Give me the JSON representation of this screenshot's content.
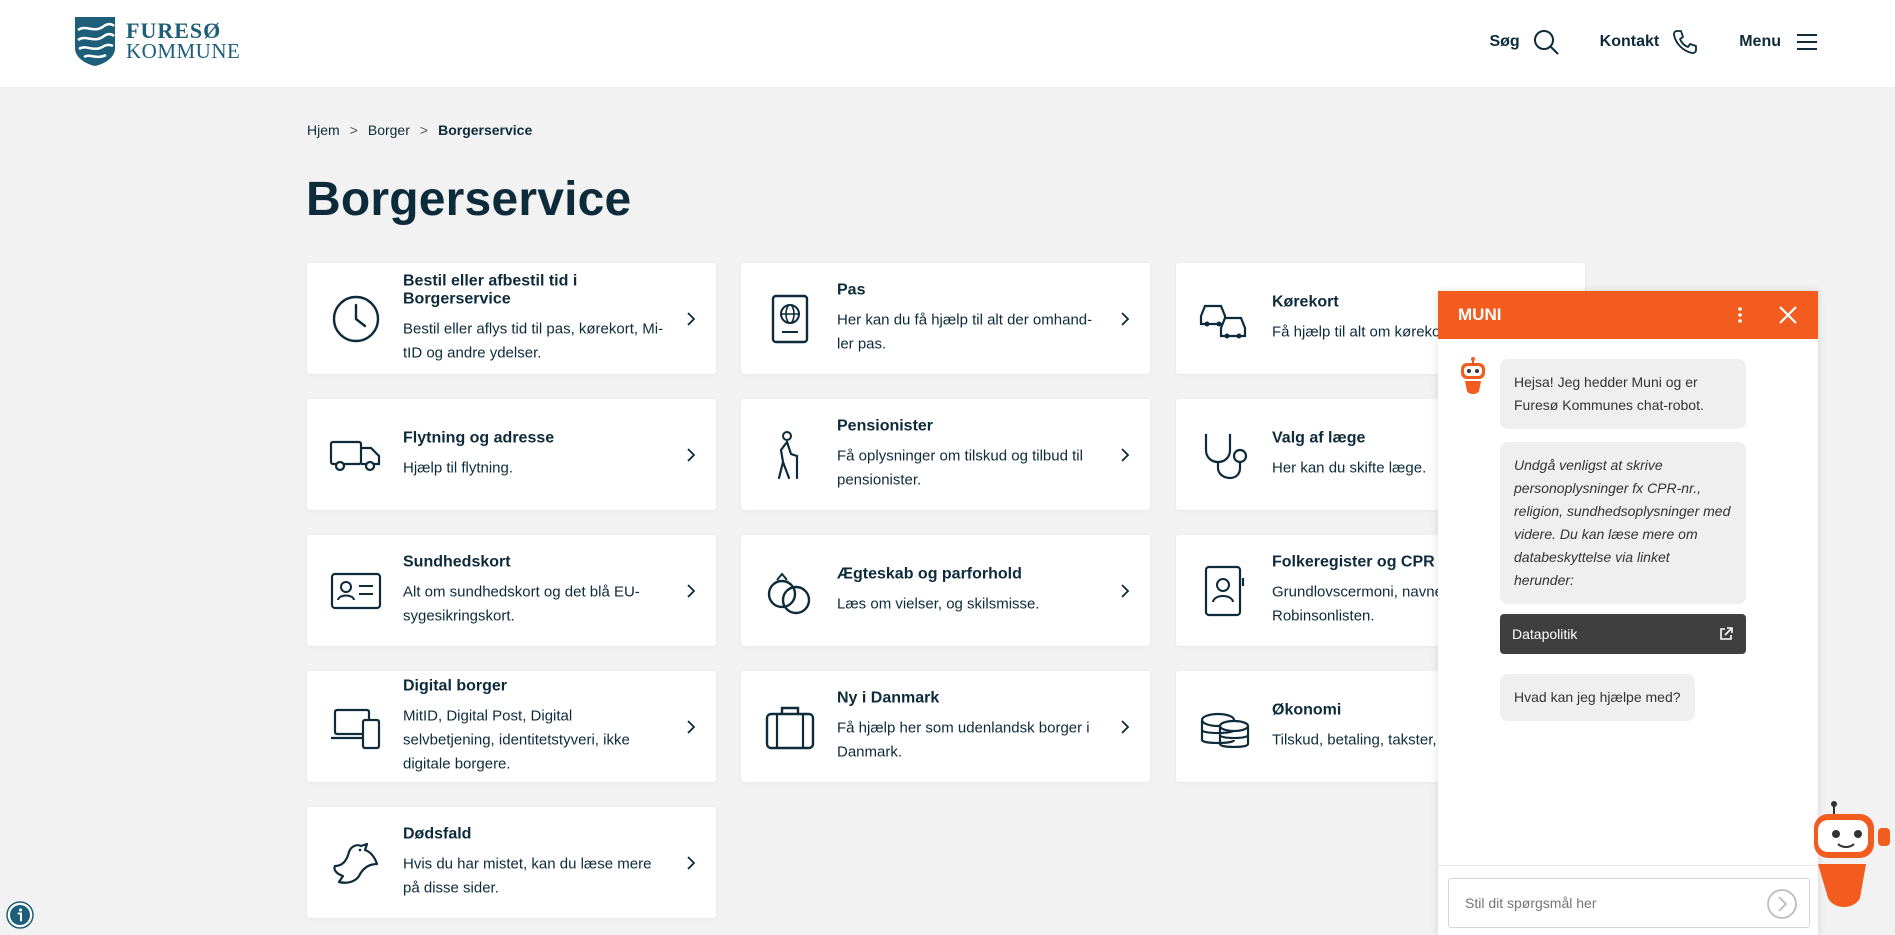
{
  "header": {
    "logo_line1": "FURESØ",
    "logo_line2": "KOMMUNE",
    "nav": {
      "search": "Søg",
      "contact": "Kontakt",
      "menu": "Menu"
    }
  },
  "breadcrumb": {
    "home": "Hjem",
    "sep": ">",
    "parent": "Borger",
    "current": "Borgerservice"
  },
  "page_title": "Borgerservice",
  "cards": [
    {
      "title": "Bestil eller afbestil tid i Borgerservice",
      "desc": "Bestil eller aflys tid til pas, kørekort, Mi-tID og andre ydelser.",
      "icon": "clock-icon"
    },
    {
      "title": "Pas",
      "desc": "Her kan du få hjælp til alt der omhand-ler pas.",
      "icon": "passport-icon"
    },
    {
      "title": "Kørekort",
      "desc": "Få hjælp til alt om kørekort.",
      "icon": "cars-icon"
    },
    {
      "title": "Flytning og adresse",
      "desc": "Hjælp til flytning.",
      "icon": "truck-icon"
    },
    {
      "title": "Pensionister",
      "desc": "Få oplysninger om tilskud og tilbud til pensionister.",
      "icon": "elderly-icon"
    },
    {
      "title": "Valg af læge",
      "desc": "Her kan du skifte læge.",
      "icon": "stethoscope-icon"
    },
    {
      "title": "Sundhedskort",
      "desc": "Alt om sundhedskort og det blå EU-sygesikringskort.",
      "icon": "id-card-icon"
    },
    {
      "title": "Ægteskab og parforhold",
      "desc": "Læs om vielser, og skilsmisse.",
      "icon": "rings-icon"
    },
    {
      "title": "Folkeregister og CPR",
      "desc": "Grundlovscermoni, navne-ændring, Robinsonlisten.",
      "icon": "contact-book-icon"
    },
    {
      "title": "Digital borger",
      "desc": "MitID, Digital Post, Digital selvbetjening, identitetstyveri, ikke digitale borgere.",
      "icon": "devices-icon"
    },
    {
      "title": "Ny i Danmark",
      "desc": "Få hjælp her som udenlandsk borger i Danmark.",
      "icon": "suitcase-icon"
    },
    {
      "title": "Økonomi",
      "desc": "Tilskud, betaling, takster, Skat.",
      "icon": "coins-icon"
    },
    {
      "title": "Dødsfald",
      "desc": "Hvis du har mistet, kan du læse mere på disse sider.",
      "icon": "dove-icon"
    }
  ],
  "chat": {
    "title": "MUNI",
    "greeting": "Hejsa! Jeg hedder Muni og er Furesø Kommunes chat-robot.",
    "notice": "Undgå venligst at skrive personoplysninger fx CPR-nr., religion, sundhedsoplysninger med videre. Du kan læse mere om databeskyttelse via linket herunder:",
    "link_label": "Datapolitik",
    "question": "Hvad kan jeg hjælpe med?",
    "input_placeholder": "Stil dit spørgsmål her"
  },
  "colors": {
    "accent": "#f25c1e",
    "text": "#0d2b3a",
    "brand": "#1d5e79"
  }
}
